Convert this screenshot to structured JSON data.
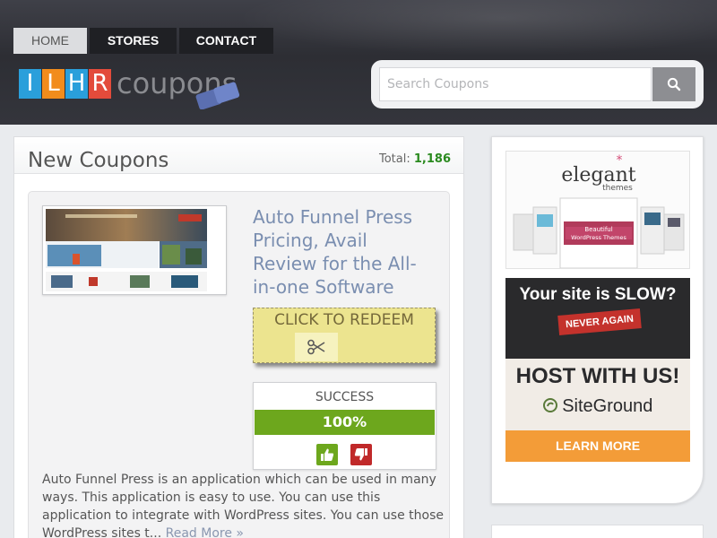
{
  "nav": {
    "tabs": [
      {
        "label": "HOME",
        "active": true
      },
      {
        "label": "STORES",
        "active": false
      },
      {
        "label": "CONTACT",
        "active": false
      }
    ]
  },
  "logo": {
    "letters": [
      "I",
      "L",
      "H",
      "R"
    ],
    "letter_colors": [
      "#2a9fdb",
      "#f28c1c",
      "#2a9fdb",
      "#e34b3b"
    ],
    "word": "coupons"
  },
  "search": {
    "placeholder": "Search Coupons",
    "icon": "search-icon"
  },
  "main": {
    "title": "New Coupons",
    "total_label": "Total:",
    "total_count": "1,186"
  },
  "coupon": {
    "title": "Auto Funnel Press Pricing, Avail Review for the All-in-one Software",
    "redeem_label": "CLICK TO REDEEM",
    "redeem_icon": "scissors-icon",
    "success_label": "SUCCESS",
    "success_rate": "100%",
    "vote_up_icon": "thumbs-up-icon",
    "vote_down_icon": "thumbs-down-icon",
    "description": "Auto Funnel Press is an application which can be used in many ways. This application is easy to use. You can use this application to integrate with WordPress sites. You can use those WordPress sites t...",
    "read_more": "Read More »"
  },
  "sidebar": {
    "ad1": {
      "brand": "elegant",
      "brand_sub": "themes",
      "banner": "Beautiful WordPress Themes"
    },
    "ad2": {
      "headline": "Your site is SLOW?",
      "stamp": "NEVER AGAIN",
      "host": "HOST WITH US!",
      "brand": "SiteGround",
      "cta": "LEARN MORE"
    }
  },
  "colors": {
    "accent_green": "#6da71d",
    "accent_red": "#c0292a",
    "title_blue": "#7a8eb0",
    "redeem_yellow": "#ece48f",
    "cta_orange": "#f39c38"
  }
}
